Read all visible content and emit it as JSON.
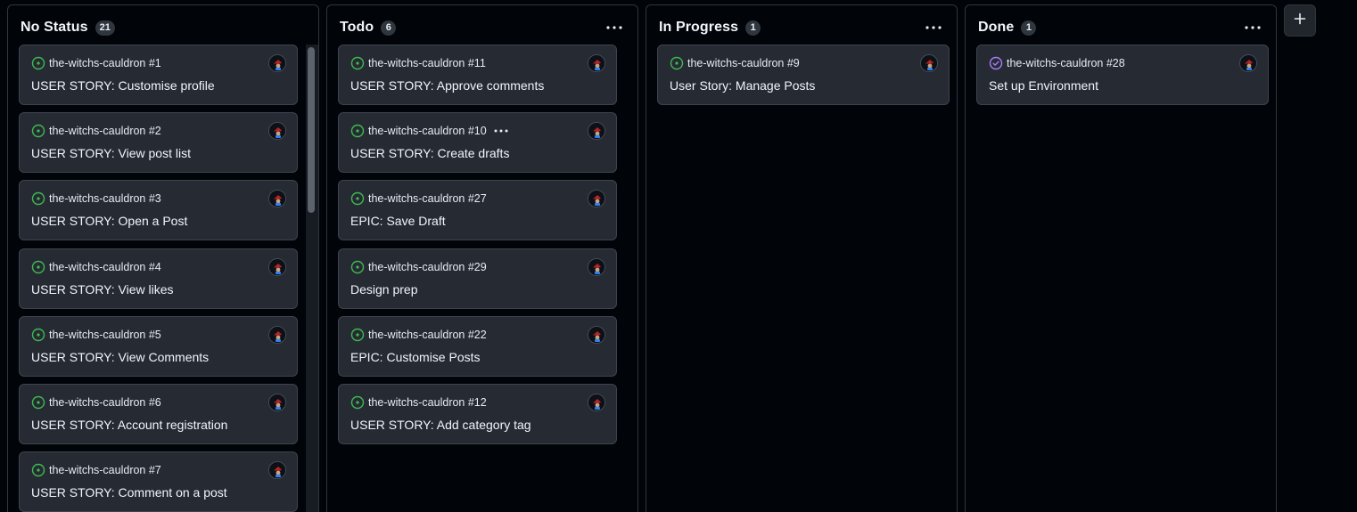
{
  "columns": [
    {
      "title": "No Status",
      "count": "21",
      "cards": [
        {
          "ref": "the-witchs-cauldron #1",
          "title": "USER STORY: Customise profile",
          "state": "open"
        },
        {
          "ref": "the-witchs-cauldron #2",
          "title": "USER STORY: View post list",
          "state": "open"
        },
        {
          "ref": "the-witchs-cauldron #3",
          "title": "USER STORY: Open a Post",
          "state": "open"
        },
        {
          "ref": "the-witchs-cauldron #4",
          "title": "USER STORY: View likes",
          "state": "open"
        },
        {
          "ref": "the-witchs-cauldron #5",
          "title": "USER STORY: View Comments",
          "state": "open"
        },
        {
          "ref": "the-witchs-cauldron #6",
          "title": "USER STORY: Account registration",
          "state": "open"
        },
        {
          "ref": "the-witchs-cauldron #7",
          "title": "USER STORY: Comment on a post",
          "state": "open"
        }
      ]
    },
    {
      "title": "Todo",
      "count": "6",
      "cards": [
        {
          "ref": "the-witchs-cauldron #11",
          "title": "USER STORY: Approve comments",
          "state": "open"
        },
        {
          "ref": "the-witchs-cauldron #10",
          "title": "USER STORY: Create drafts",
          "state": "open"
        },
        {
          "ref": "the-witchs-cauldron #27",
          "title": "EPIC: Save Draft",
          "state": "open"
        },
        {
          "ref": "the-witchs-cauldron #29",
          "title": "Design prep",
          "state": "open"
        },
        {
          "ref": "the-witchs-cauldron #22",
          "title": "EPIC: Customise Posts",
          "state": "open"
        },
        {
          "ref": "the-witchs-cauldron #12",
          "title": "USER STORY: Add category tag",
          "state": "open"
        }
      ]
    },
    {
      "title": "In Progress",
      "count": "1",
      "cards": [
        {
          "ref": "the-witchs-cauldron #9",
          "title": "User Story: Manage Posts",
          "state": "open"
        }
      ]
    },
    {
      "title": "Done",
      "count": "1",
      "cards": [
        {
          "ref": "the-witchs-cauldron #28",
          "title": "Set up Environment",
          "state": "closed"
        }
      ]
    }
  ],
  "icons": {
    "open": "issue-opened-icon",
    "closed": "issue-closed-icon",
    "column_menu": "kebab-horizontal-icon",
    "add_column": "plus-icon",
    "avatar": "avatar"
  },
  "colors": {
    "background": "#010409",
    "card": "#262a33",
    "border": "#30363d",
    "open_green": "#3fb950",
    "closed_purple": "#ab7df8"
  }
}
